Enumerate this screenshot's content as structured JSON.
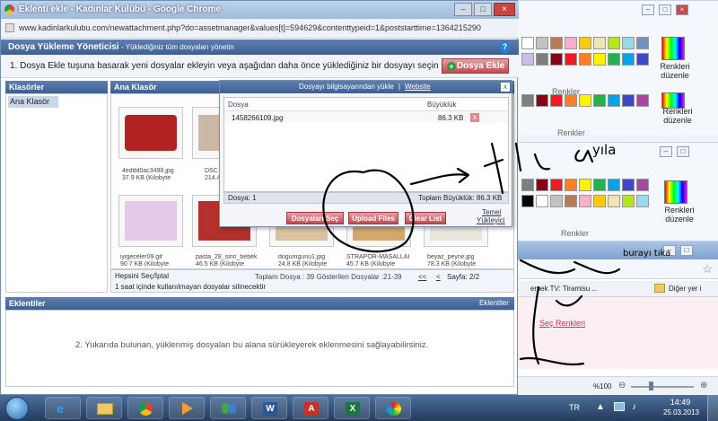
{
  "window": {
    "title": "Eklenti ekle - Kadınlar Kulübü - Google Chrome",
    "url": "www.kadinlarkulubu.com/newattachment.php?do=assetmanager&values[t]=594629&contenttypeid=1&poststarttime=1364215290"
  },
  "manager": {
    "title": "Dosya Yükleme Yöneticisi",
    "subtitle": "- Yüklediğiniz tüm dosyaları yönetin",
    "help_icon": "?",
    "instruction": "1. Dosya Ekle tuşuna basarak yeni dosyalar ekleyin veya aşağıdan daha önce yüklediğiniz bir dosyayı seçin",
    "add_button": "Dosya Ekle"
  },
  "folders": {
    "header": "Klasörler",
    "items": [
      "Ana Klasör"
    ],
    "main_header": "Ana Klasör"
  },
  "thumbnails": [
    {
      "name": "4eddd0ac3498.jpg",
      "size": "37.9 KB (Kilobyte",
      "color": "#b32222"
    },
    {
      "name": "DSC",
      "size": "214.4",
      "color": "#c9b8a6"
    },
    {
      "name": "iyigeceler09.gif",
      "size": "90.7 KB (Kilobyte",
      "color": "#e6c9ea"
    },
    {
      "name": "pasta_28_sirin_bebek",
      "size": "46.5 KB (Kilobyte",
      "color": "#b3302d"
    },
    {
      "name": "dogumgunu1.jpg",
      "size": "24.8 KB (Kilobyte",
      "color": "#d9c2a0"
    },
    {
      "name": "STRAPOR-MASALLAI",
      "size": "45.7 KB (Kilobyte",
      "color": "#d6a66b"
    },
    {
      "name": "beyaz_peynir.jpg",
      "size": "78.3 KB (Kilobyte",
      "color": "#e9e7dd"
    }
  ],
  "footer_row": {
    "select_all": "Hepsini Seç/İptal",
    "note": "1 saat içinde kullanılmayan dosyalar silinecektir",
    "total": "Toplam Dosya : 39 Gösterilen Dosyalar :21-39",
    "pager_prev": "<<",
    "pager_prev2": "<",
    "page": "Sayfa: 2/2"
  },
  "upload_dialog": {
    "title": "Dosyayı bilgisayarından yükle",
    "separator": "|",
    "website_link": "Website",
    "col_file": "Dosya",
    "col_size": "Büyüklük",
    "file_name": "1458266109.jpg",
    "file_size": "86.3 KB",
    "remove": "x",
    "count": "Dosya: 1",
    "total_size": "Toplam Büyüklük: 86.3 KB",
    "btn_select": "Dosyaları Seç",
    "btn_upload": "Upload Files",
    "btn_clear": "Clear List",
    "basic_link_1": "Temel",
    "basic_link_2": "Yükleyici",
    "close": "x"
  },
  "attachments": {
    "header": "Eklentiler",
    "header_right": "Eklentiler",
    "instruction": "2. Yukarıda bulunan, yüklenmiş dosyaları bu alana sürükleyerek eklenmesini sağlayabilirsiniz."
  },
  "paint": {
    "edit_colors": "Renkleri düzenle",
    "group_label": "Renkler",
    "palette": [
      "#ffffff",
      "#c3c3c3",
      "#b97a57",
      "#ffaec9",
      "#ffc90e",
      "#efe4b0",
      "#b5e61d",
      "#99d9ea",
      "#7092be",
      "#c8bfe7",
      "#7f7f7f",
      "#880015",
      "#ed1c24",
      "#ff7f27",
      "#fff200",
      "#22b14c",
      "#00a2e8",
      "#3f48cc",
      "#a349a4",
      "#000000"
    ]
  },
  "browser_right": {
    "bookmark_text": "emek TV: Tiramisu ...",
    "other_bookmarks": "Diğer yer i",
    "link_text": "Seç Renkleri",
    "zoom": "%100"
  },
  "annotations": {
    "scribble_1": "yıla",
    "scribble_2": "burayı tıka"
  },
  "taskbar": {
    "lang": "TR",
    "time": "14:49",
    "date": "25.03.2013"
  }
}
